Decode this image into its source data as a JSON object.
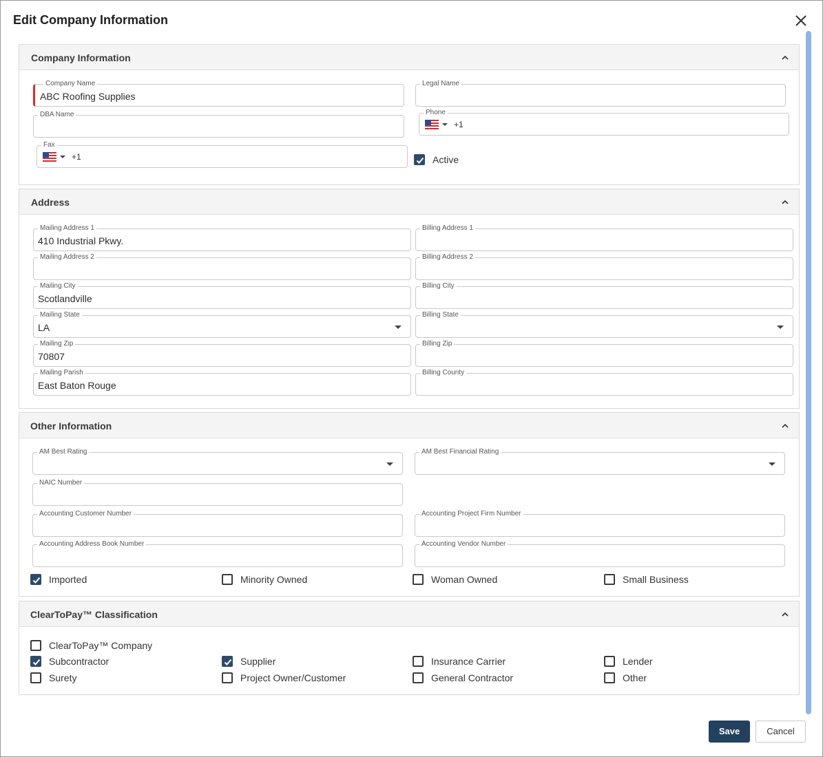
{
  "dialog": {
    "title": "Edit Company Information",
    "save_label": "Save",
    "cancel_label": "Cancel"
  },
  "company_info": {
    "title": "Company Information",
    "company_name": {
      "label": "Company Name",
      "value": "ABC Roofing Supplies"
    },
    "legal_name": {
      "label": "Legal Name",
      "value": ""
    },
    "dba_name": {
      "label": "DBA Name",
      "value": ""
    },
    "phone": {
      "label": "Phone",
      "dial_code": "+1"
    },
    "fax": {
      "label": "Fax",
      "dial_code": "+1"
    },
    "active": {
      "label": "Active",
      "checked": true
    }
  },
  "address": {
    "title": "Address",
    "mailing_address_1": {
      "label": "Mailing Address 1",
      "value": "410 Industrial Pkwy."
    },
    "billing_address_1": {
      "label": "Billing Address 1",
      "value": ""
    },
    "mailing_address_2": {
      "label": "Mailing Address 2",
      "value": ""
    },
    "billing_address_2": {
      "label": "Billing Address 2",
      "value": ""
    },
    "mailing_city": {
      "label": "Mailing City",
      "value": "Scotlandville"
    },
    "billing_city": {
      "label": "Billing City",
      "value": ""
    },
    "mailing_state": {
      "label": "Mailing State",
      "value": "LA"
    },
    "billing_state": {
      "label": "Billing State",
      "value": ""
    },
    "mailing_zip": {
      "label": "Mailing Zip",
      "value": "70807"
    },
    "billing_zip": {
      "label": "Billing Zip",
      "value": ""
    },
    "mailing_parish": {
      "label": "Mailing Parish",
      "value": "East Baton Rouge"
    },
    "billing_county": {
      "label": "Billing County",
      "value": ""
    }
  },
  "other_info": {
    "title": "Other Information",
    "am_best_rating": {
      "label": "AM Best Rating",
      "value": ""
    },
    "am_best_financial_rating": {
      "label": "AM Best Financial Rating",
      "value": ""
    },
    "naic_number": {
      "label": "NAIC Number",
      "value": ""
    },
    "accounting_customer_number": {
      "label": "Accounting Customer Number",
      "value": ""
    },
    "accounting_project_firm_number": {
      "label": "Accounting Project Firm Number",
      "value": ""
    },
    "accounting_address_book_number": {
      "label": "Accounting Address Book Number",
      "value": ""
    },
    "accounting_vendor_number": {
      "label": "Accounting Vendor Number",
      "value": ""
    },
    "checkboxes": [
      {
        "label": "Imported",
        "checked": true
      },
      {
        "label": "Minority Owned",
        "checked": false
      },
      {
        "label": "Woman Owned",
        "checked": false
      },
      {
        "label": "Small Business",
        "checked": false
      }
    ]
  },
  "classification": {
    "title": "ClearToPay™ Classification",
    "checkboxes": [
      {
        "label": "ClearToPay™ Company",
        "checked": false
      },
      {
        "label": "Subcontractor",
        "checked": true
      },
      {
        "label": "Supplier",
        "checked": true
      },
      {
        "label": "Insurance Carrier",
        "checked": false
      },
      {
        "label": "Lender",
        "checked": false
      },
      {
        "label": "Surety",
        "checked": false
      },
      {
        "label": "Project Owner/Customer",
        "checked": false
      },
      {
        "label": "General Contractor",
        "checked": false
      },
      {
        "label": "Other",
        "checked": false
      }
    ]
  },
  "colors": {
    "accent": "#23405f",
    "required": "#d92b2b",
    "scrollbar": "#8fb5e0"
  }
}
